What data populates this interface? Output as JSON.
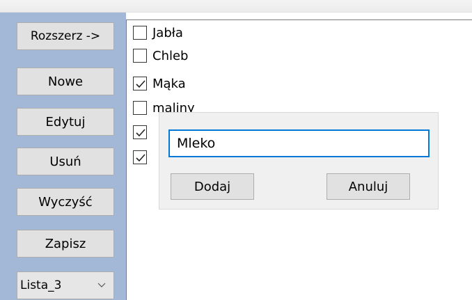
{
  "sidebar": {
    "expand_label": "Rozszerz ->",
    "new_label": "Nowe",
    "edit_label": "Edytuj",
    "delete_label": "Usuń",
    "clear_label": "Wyczyść",
    "save_label": "Zapisz",
    "list_select": {
      "selected": "Lista_3"
    }
  },
  "list": {
    "items": [
      {
        "label": "Jabła",
        "checked": false
      },
      {
        "label": "Chleb",
        "checked": false
      },
      {
        "label": "Mąka",
        "checked": true
      },
      {
        "label": "maliny",
        "checked": false
      },
      {
        "label": "",
        "checked": true
      },
      {
        "label": "",
        "checked": true
      }
    ]
  },
  "dialog": {
    "input_value": "Mleko",
    "add_label": "Dodaj",
    "cancel_label": "Anuluj"
  },
  "colors": {
    "panel_bg": "#a3b8d6",
    "focus_border": "#0078d7"
  }
}
